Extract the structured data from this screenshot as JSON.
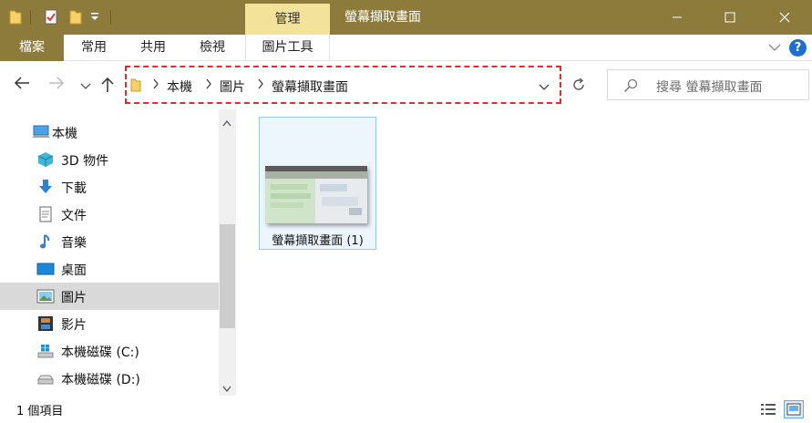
{
  "titlebar": {
    "manage_tab": "管理",
    "window_title": "螢幕擷取畫面",
    "bg_color": "#8c7b3a"
  },
  "ribbon": {
    "tabs": [
      {
        "label": "檔案"
      },
      {
        "label": "常用"
      },
      {
        "label": "共用"
      },
      {
        "label": "檢視"
      },
      {
        "label": "圖片工具"
      }
    ],
    "help": "?"
  },
  "address": {
    "breadcrumbs": [
      "本機",
      "圖片",
      "螢幕擷取畫面"
    ],
    "search_placeholder": "搜尋 螢幕擷取畫面"
  },
  "nav": {
    "items": [
      {
        "label": "本機",
        "icon": "computer-icon"
      },
      {
        "label": "3D 物件",
        "icon": "3d-objects-icon"
      },
      {
        "label": "下載",
        "icon": "download-arrow-icon"
      },
      {
        "label": "文件",
        "icon": "document-icon"
      },
      {
        "label": "音樂",
        "icon": "music-note-icon"
      },
      {
        "label": "桌面",
        "icon": "desktop-icon"
      },
      {
        "label": "圖片",
        "icon": "pictures-icon",
        "selected": true
      },
      {
        "label": "影片",
        "icon": "film-icon"
      },
      {
        "label": "本機磁碟 (C:)",
        "icon": "windows-drive-icon"
      },
      {
        "label": "本機磁碟 (D:)",
        "icon": "drive-icon"
      }
    ]
  },
  "content": {
    "files": [
      {
        "name": "螢幕擷取畫面 (1)"
      }
    ]
  },
  "status": {
    "item_count": "1 個項目"
  },
  "colors": {
    "accent": "#8c7b3a",
    "manage_tab": "#f3e39a",
    "highlight": "#e52a2a",
    "selection": "#d9d9d9"
  }
}
